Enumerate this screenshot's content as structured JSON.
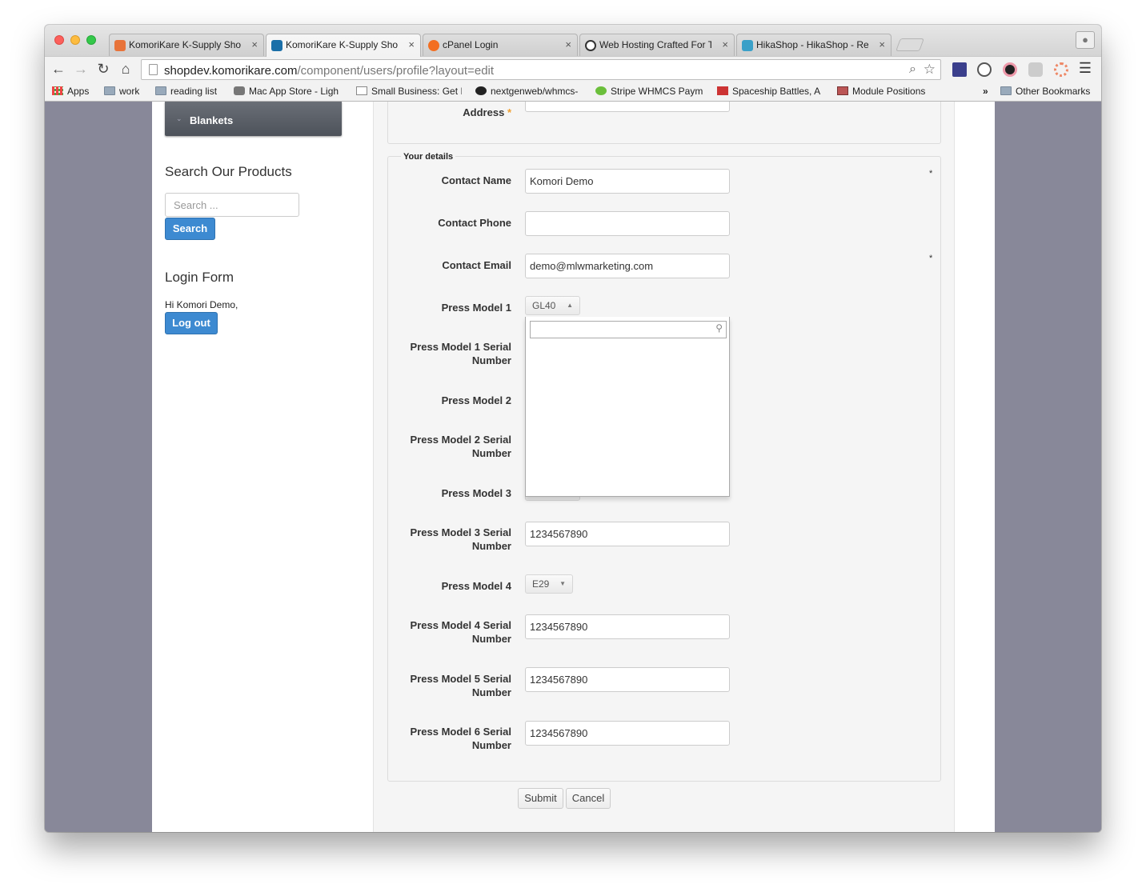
{
  "browser": {
    "tabs": [
      {
        "title": "KomoriKare K-Supply Shop",
        "favicon_color": "#e8733a",
        "active": false
      },
      {
        "title": "KomoriKare K-Supply Shop",
        "favicon_color": "#1b6fa8",
        "active": true
      },
      {
        "title": "cPanel Login",
        "favicon_color": "#f36f21",
        "active": false
      },
      {
        "title": "Web Hosting Crafted For To",
        "favicon_color": "#333333",
        "active": false
      },
      {
        "title": "HikaShop - HikaShop - Rep",
        "favicon_color": "#3aa0c8",
        "active": false
      }
    ],
    "tab_close": "×",
    "nav": {
      "back": "←",
      "forward": "→",
      "reload": "↻",
      "home": "⌂"
    },
    "url_host": "shopdev.komorikare.com",
    "url_path": "/component/users/profile?layout=edit",
    "bookmarks": [
      {
        "label": "Apps",
        "icon": "apps-grid-icon"
      },
      {
        "label": "work",
        "icon": "folder-icon"
      },
      {
        "label": "reading list",
        "icon": "folder-icon"
      },
      {
        "label": "Mac App Store - Ligh",
        "icon": "apple-icon"
      },
      {
        "label": "Small Business: Get I",
        "icon": "page-icon"
      },
      {
        "label": "nextgenweb/whmcs-",
        "icon": "github-icon"
      },
      {
        "label": "Stripe WHMCS Paym",
        "icon": "stripe-icon"
      },
      {
        "label": "Spaceship Battles, A",
        "icon": "game-icon"
      },
      {
        "label": "Module Positions",
        "icon": "module-icon"
      }
    ],
    "bookmarks_more": "»",
    "other_bookmarks": "Other Bookmarks"
  },
  "sidebar": {
    "category_item": "Blankets",
    "search_heading": "Search Our Products",
    "search_placeholder": "Search ...",
    "search_button": "Search",
    "login_heading": "Login Form",
    "greeting": "Hi Komori Demo,",
    "logout_button": "Log out"
  },
  "form": {
    "address_label": "Address",
    "required_mark": "*",
    "legend": "Your details",
    "contact_name_label": "Contact Name",
    "contact_name_value": "Komori Demo",
    "contact_phone_label": "Contact Phone",
    "contact_phone_value": "",
    "contact_email_label": "Contact Email",
    "contact_email_value": "demo@mlwmarketing.com",
    "press_model_1_label": "Press Model 1",
    "press_model_1_value": "GL40",
    "press_model_1_serial_label_line1": "Press Model 1 Serial",
    "press_model_1_serial_label_line2": "Number",
    "press_model_2_label": "Press Model 2",
    "press_model_2_serial_label_line1": "Press Model 2 Serial",
    "press_model_2_serial_label_line2": "Number",
    "press_model_3_label": "Press Model 3",
    "press_model_3_serial_label_line1": "Press Model 3 Serial",
    "press_model_3_serial_label_line2": "Number",
    "press_model_3_serial_value": "1234567890",
    "press_model_4_label": "Press Model 4",
    "press_model_4_value": "E29",
    "press_model_4_serial_label_line1": "Press Model 4 Serial",
    "press_model_4_serial_label_line2": "Number",
    "press_model_4_serial_value": "1234567890",
    "press_model_5_serial_label_line1": "Press Model 5 Serial",
    "press_model_5_serial_label_line2": "Number",
    "press_model_5_serial_value": "1234567890",
    "press_model_6_serial_label_line1": "Press Model 6 Serial",
    "press_model_6_serial_label_line2": "Number",
    "press_model_6_serial_value": "1234567890",
    "submit_button": "Submit",
    "cancel_button": "Cancel"
  }
}
